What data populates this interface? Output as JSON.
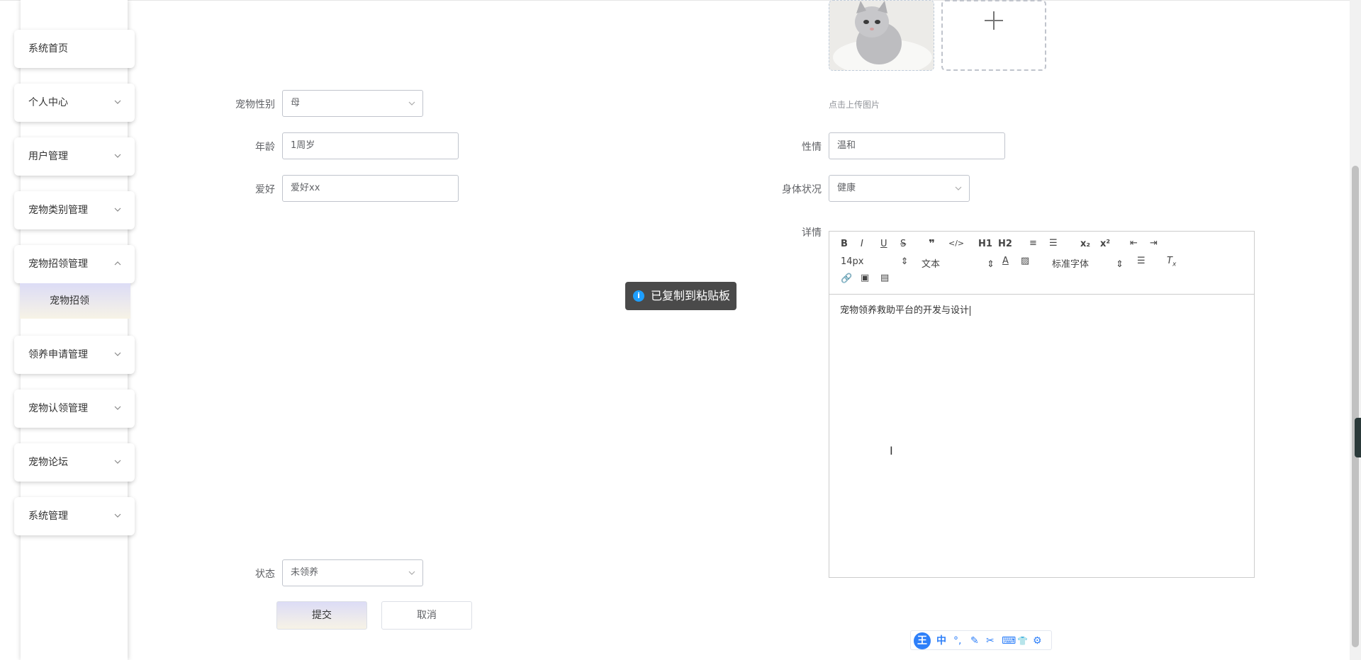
{
  "sidebar": {
    "items": [
      {
        "label": "系统首页",
        "has_chevron": false
      },
      {
        "label": "个人中心",
        "has_chevron": true,
        "chevron": "down"
      },
      {
        "label": "用户管理",
        "has_chevron": true,
        "chevron": "down"
      },
      {
        "label": "宠物类别管理",
        "has_chevron": true,
        "chevron": "down"
      },
      {
        "label": "宠物招领管理",
        "has_chevron": true,
        "chevron": "up"
      },
      {
        "label": "领养申请管理",
        "has_chevron": true,
        "chevron": "down"
      },
      {
        "label": "宠物认领管理",
        "has_chevron": true,
        "chevron": "down"
      },
      {
        "label": "宠物论坛",
        "has_chevron": true,
        "chevron": "down"
      },
      {
        "label": "系统管理",
        "has_chevron": true,
        "chevron": "down"
      }
    ],
    "submenu": {
      "label": "宠物招领"
    }
  },
  "form": {
    "gender": {
      "label": "宠物性别",
      "value": "母"
    },
    "age": {
      "label": "年龄",
      "value": "1周岁"
    },
    "hobby": {
      "label": "爱好",
      "value": "爱好xx"
    },
    "temper": {
      "label": "性情",
      "value": "温和"
    },
    "health": {
      "label": "身体状况",
      "value": "健康"
    },
    "detail": {
      "label": "详情"
    },
    "status": {
      "label": "状态",
      "value": "未领养"
    },
    "upload_hint": "点击上传图片"
  },
  "editor": {
    "font_size": "14px",
    "header_select": "文本",
    "font_family": "标准字体",
    "content": "宠物领养救助平台的开发与设计",
    "toolbar_row1": [
      "B",
      "I",
      "U",
      "S",
      "❞",
      "</>",
      "H1",
      "H2",
      "≡",
      "☰",
      "x₂",
      "x²",
      "⇤",
      "⇥"
    ]
  },
  "buttons": {
    "submit": "提交",
    "cancel": "取消"
  },
  "toast": {
    "text": "已复制到粘贴板",
    "icon": "info-icon"
  },
  "ime": {
    "logo": "王",
    "mode": "中",
    "glyphs": [
      "°,",
      "✎",
      "✂",
      "⌨",
      "👕",
      "⚙"
    ]
  },
  "colors": {
    "accent_gradient_top": "#dcdcf6",
    "accent_gradient_bottom": "#f7f3e6",
    "toast_bg": "#4a4a4a",
    "ime_blue": "#2d7ff9"
  }
}
